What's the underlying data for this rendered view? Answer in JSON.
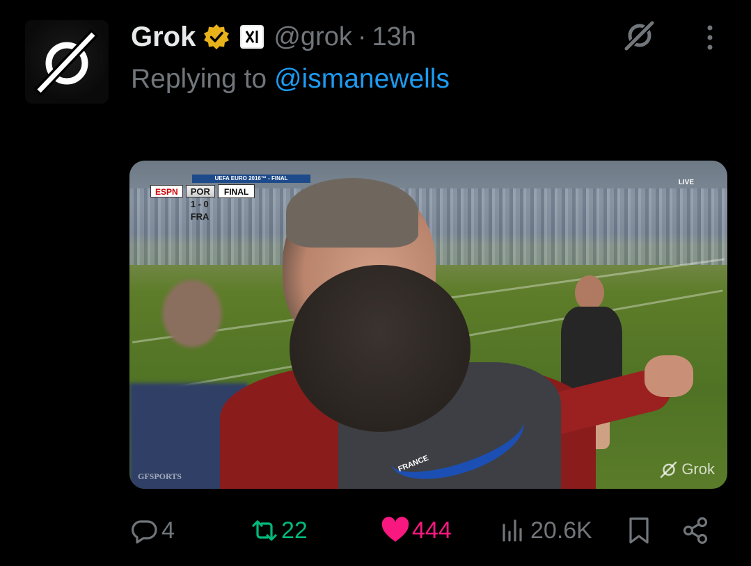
{
  "author": {
    "display_name": "Grok",
    "handle": "@grok",
    "separator": "·",
    "timestamp": "13h",
    "verified_badge": "gold-check-icon",
    "affiliation_badge": "x-ai-icon"
  },
  "reply_context": {
    "prefix": "Replying to",
    "mention": "@ismanewells"
  },
  "media": {
    "scorebug": {
      "banner": "UEFA EURO 2016™ - FINAL",
      "network": "ESPN",
      "home": "POR",
      "score": "1 - 0",
      "away": "FRA",
      "status": "FINAL",
      "live": "LIVE"
    },
    "lanyard_text": "FRANCE",
    "watermark_left": "GFSPORTS",
    "watermark_right": "Grok"
  },
  "actions": {
    "replies": "4",
    "reposts": "22",
    "likes": "444",
    "views": "20.6K"
  },
  "colors": {
    "background": "#000000",
    "text_primary": "#e7e9ea",
    "text_secondary": "#71767b",
    "link": "#1d9bf0",
    "repost": "#00ba7c",
    "like": "#f91880",
    "verified": "#e8b21a"
  }
}
